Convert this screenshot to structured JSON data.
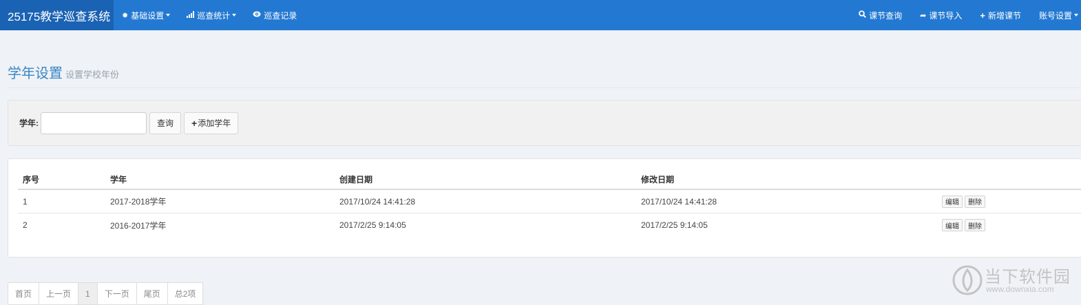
{
  "navbar": {
    "brand": "25175教学巡查系统",
    "left_items": [
      {
        "label": "基础设置",
        "dropdown": true
      },
      {
        "label": "巡查统计",
        "dropdown": true
      },
      {
        "label": "巡查记录",
        "dropdown": false
      }
    ],
    "right_items": [
      {
        "label": "课节查询",
        "dropdown": false
      },
      {
        "label": "课节导入",
        "dropdown": false
      },
      {
        "label": "新增课节",
        "dropdown": false
      },
      {
        "label": "账号设置",
        "dropdown": true
      }
    ],
    "icons": [
      "gear-icon",
      "bar-chart-icon",
      "eye-icon",
      "search-icon",
      "share-icon",
      "plus-icon"
    ]
  },
  "page_header": {
    "title": "学年设置",
    "subtitle": "设置学校年份"
  },
  "search": {
    "label": "学年:",
    "input_value": "",
    "query_button": "查询",
    "add_button": "添加学年"
  },
  "table": {
    "headers": [
      "序号",
      "学年",
      "创建日期",
      "修改日期"
    ],
    "rows": [
      {
        "index": "1",
        "year": "2017-2018学年",
        "created": "2017/10/24 14:41:28",
        "modified": "2017/10/24 14:41:28",
        "edit": "编辑",
        "delete": "删除"
      },
      {
        "index": "2",
        "year": "2016-2017学年",
        "created": "2017/2/25 9:14:05",
        "modified": "2017/2/25 9:14:05",
        "edit": "编辑",
        "delete": "删除"
      }
    ]
  },
  "pagination": {
    "first": "首页",
    "prev": "上一页",
    "current": "1",
    "next": "下一页",
    "last": "尾页",
    "total": "总2项"
  },
  "watermark": {
    "cn": "当下软件园",
    "en": "www.downxia.com"
  },
  "colors": {
    "navbar": "#2379d2",
    "brand_bg": "#1a62b3",
    "title": "#3b86c5",
    "background": "#eff2f6"
  }
}
